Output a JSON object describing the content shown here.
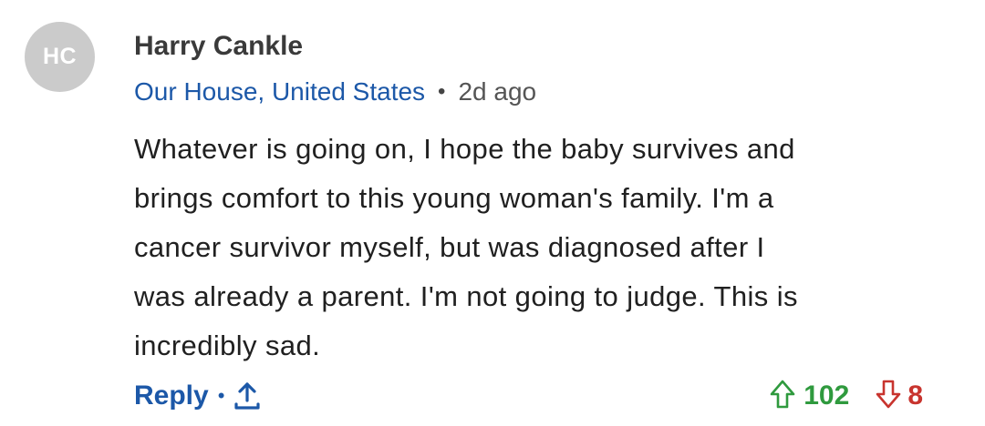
{
  "avatar": {
    "initials": "HC",
    "bg_color": "#cbcbcb"
  },
  "author": {
    "name": "Harry Cankle"
  },
  "meta": {
    "location": "Our House, United States",
    "separator": "•",
    "time": "2d ago"
  },
  "comment": {
    "text": "Whatever is going on, I hope the baby survives and\nbrings comfort to this young woman's family. I'm a\ncancer survivor myself, but was diagnosed after I\nwas already a parent.  I'm not going to judge.  This is\nincredibly sad."
  },
  "actions": {
    "reply_label": "Reply",
    "separator": "•",
    "share_icon": "share-up-arrow-icon"
  },
  "votes": {
    "up_count": "102",
    "down_count": "8",
    "up_color": "#2f9a3e",
    "down_color": "#c8342e"
  },
  "colors": {
    "link_blue": "#1c58a8",
    "text": "#202020"
  }
}
